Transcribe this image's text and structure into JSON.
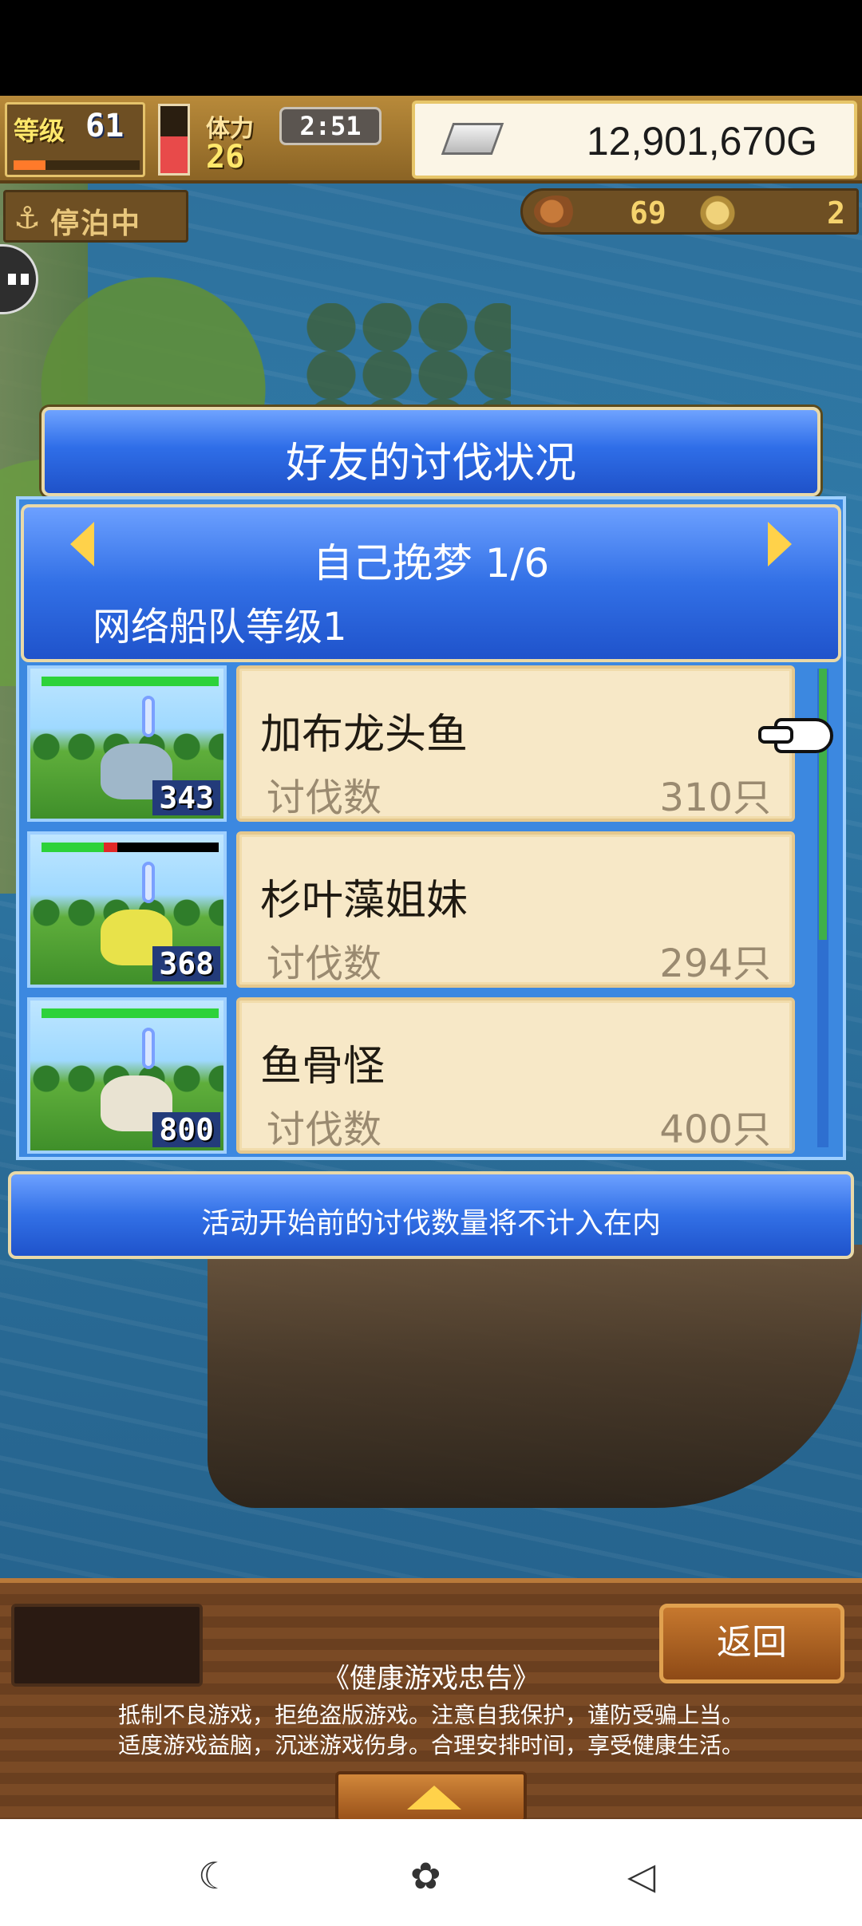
{
  "hud": {
    "level_label": "等级",
    "level": "61",
    "level_progress": 0.25,
    "stamina_level": 0.55,
    "stamina_label": "体力",
    "stamina": "26",
    "timer": "2:51",
    "gold": "12,901,670G",
    "moored_label": "停泊中",
    "resource_a": "69",
    "resource_b": "2"
  },
  "dialog": {
    "title": "好友的讨伐状况",
    "friend": "自己挽梦 1/6",
    "fleet_level": "网络船队等级1",
    "rows": [
      {
        "name": "加布龙头鱼",
        "label": "讨伐数",
        "value": "310只",
        "monster_count": "343",
        "hp": 1.0,
        "hp_red": 0.0,
        "color": "#9fb7c9"
      },
      {
        "name": "杉叶藻姐妹",
        "label": "讨伐数",
        "value": "294只",
        "monster_count": "368",
        "hp": 0.35,
        "hp_red": 0.08,
        "color": "#e8e24a"
      },
      {
        "name": "鱼骨怪",
        "label": "讨伐数",
        "value": "400只",
        "monster_count": "800",
        "hp": 1.0,
        "hp_red": 0.0,
        "color": "#e9e3d2"
      }
    ],
    "notice": "活动开始前的讨伐数量将不计入在内"
  },
  "footer": {
    "back_label": "返回",
    "health_title": "《健康游戏忠告》",
    "health_line1": "抵制不良游戏，拒绝盗版游戏。注意自我保护，谨防受骗上当。",
    "health_line2": "适度游戏益脑，沉迷游戏伤身。合理安排时间，享受健康生活。"
  },
  "navbar": {
    "icons": [
      "moon-sparkle-icon",
      "butterfly-icon",
      "back-icon"
    ],
    "glyphs": [
      "☾",
      "✿",
      "◁"
    ]
  },
  "colors": {
    "dialog_blue": "#2f6ee8",
    "card_bg": "#f7e8c7",
    "hud_wood": "#8b6425"
  }
}
